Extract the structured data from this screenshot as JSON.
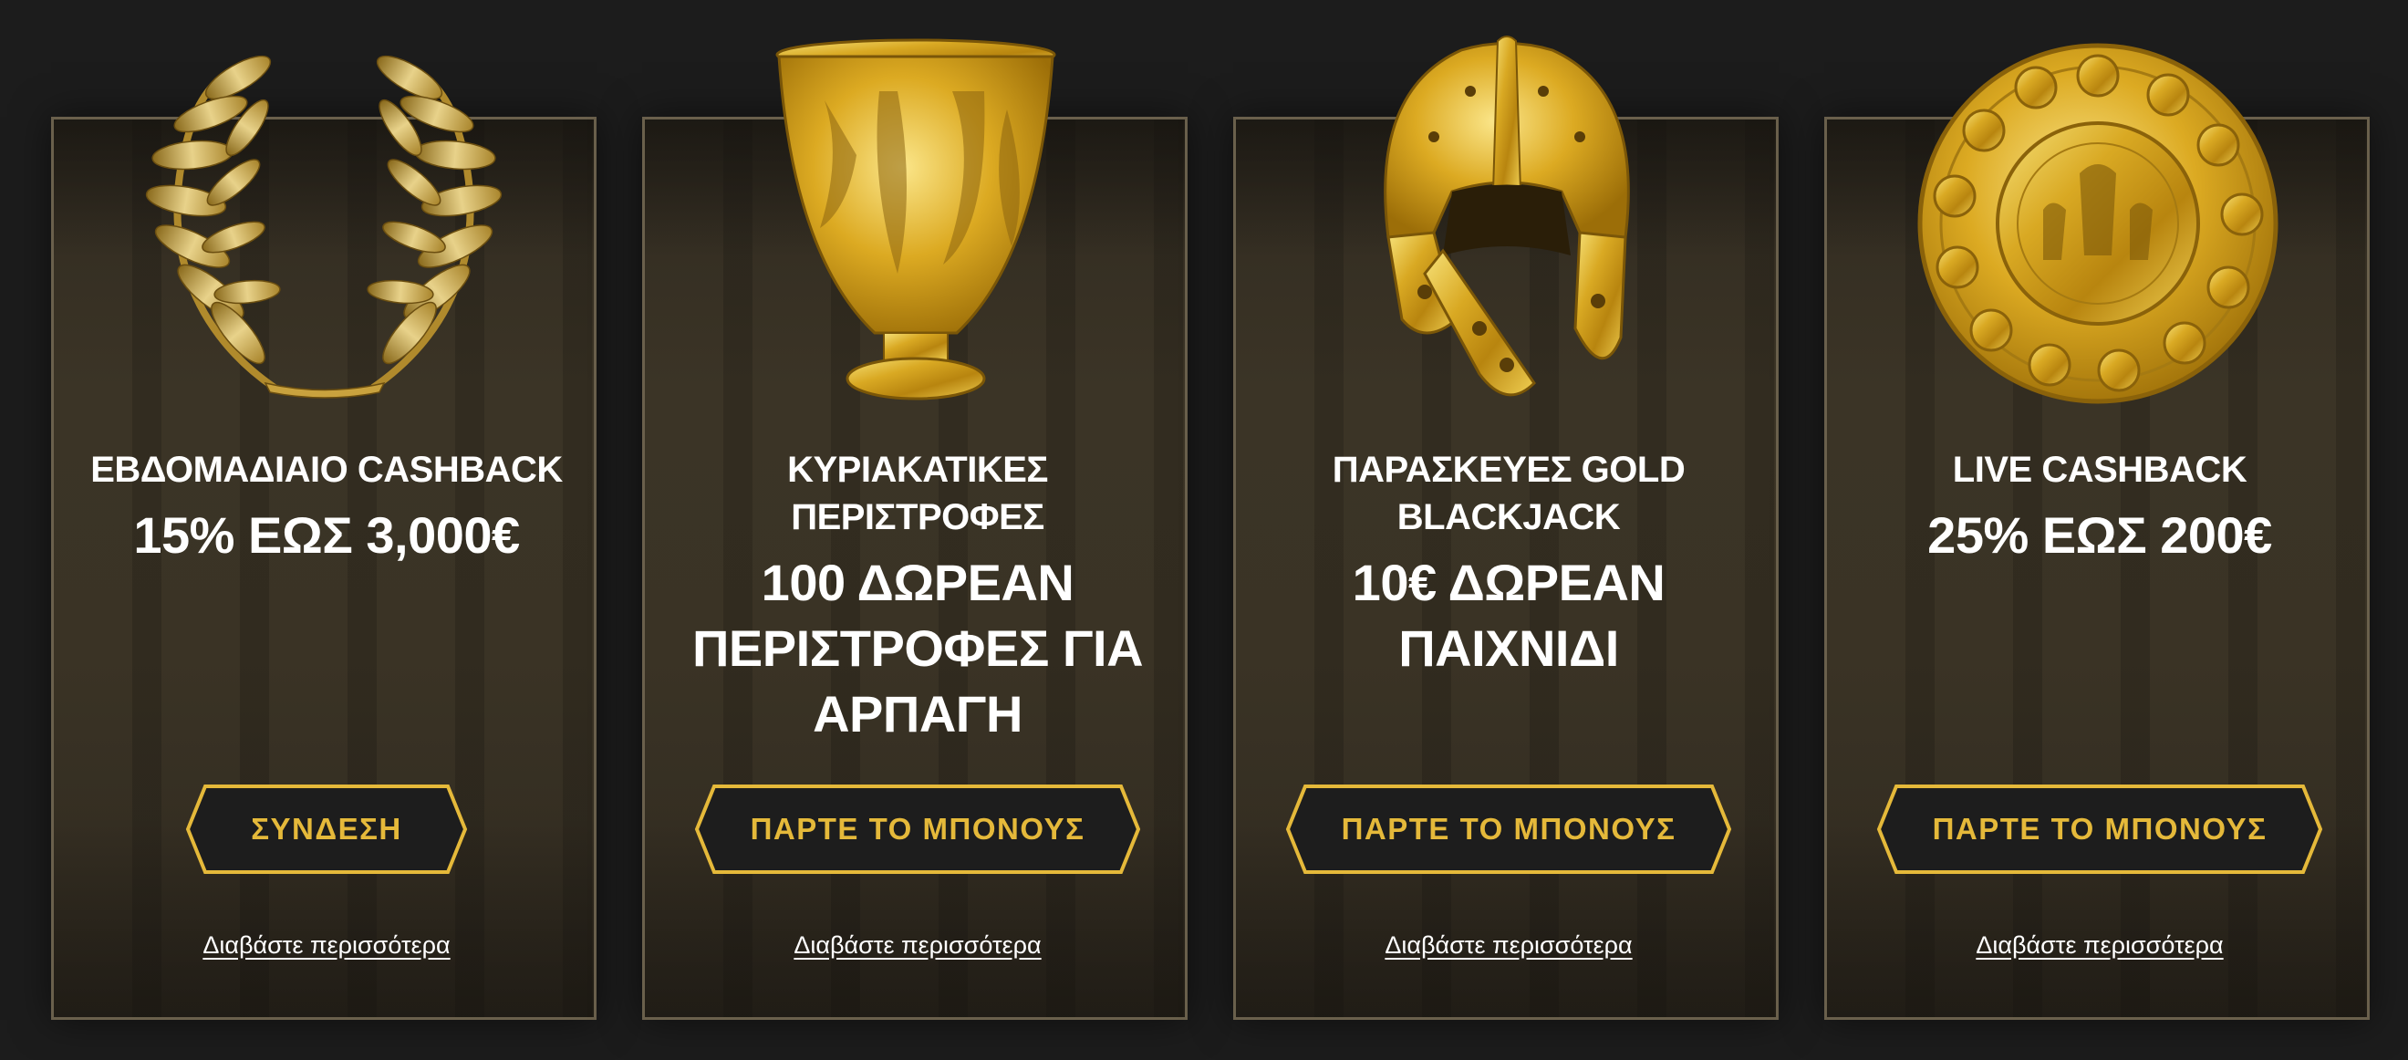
{
  "cards": [
    {
      "icon": "laurel-wreath-icon",
      "title_lines": [
        "ΕΒΔΟΜΑΔΙΑΙΟ CASHBACK"
      ],
      "subtitle_lines": [
        "15% ΕΩΣ 3,000€"
      ],
      "button_label": "ΣΥΝΔΕΣΗ",
      "link_label": "Διαβάστε περισσότερα"
    },
    {
      "icon": "golden-vase-icon",
      "title_lines": [
        "ΚΥΡΙΑΚΑΤΙΚΕΣ",
        "ΠΕΡΙΣΤΡΟΦΕΣ"
      ],
      "subtitle_lines": [
        "100 ΔΩΡΕΑΝ",
        "ΠΕΡΙΣΤΡΟΦΕΣ ΓΙΑ",
        "ΑΡΠΑΓΗ"
      ],
      "button_label": "ΠΑΡΤΕ ΤΟ ΜΠΟΝΟΥΣ",
      "link_label": "Διαβάστε περισσότερα"
    },
    {
      "icon": "golden-helmet-icon",
      "title_lines": [
        "ΠΑΡΑΣΚΕΥΕΣ GOLD",
        "BLACKJACK"
      ],
      "subtitle_lines": [
        "10€ ΔΩΡΕΑΝ",
        "ΠΑΙΧΝΙΔΙ"
      ],
      "button_label": "ΠΑΡΤΕ ΤΟ ΜΠΟΝΟΥΣ",
      "link_label": "Διαβάστε περισσότερα"
    },
    {
      "icon": "golden-shield-icon",
      "title_lines": [
        "LIVE CASHBACK"
      ],
      "subtitle_lines": [
        "25% ΕΩΣ 200€"
      ],
      "button_label": "ΠΑΡΤΕ ΤΟ ΜΠΟΝΟΥΣ",
      "link_label": "Διαβάστε περισσότερα"
    }
  ],
  "colors": {
    "page_background": "#1c1c1c",
    "card_border": "#6a604c",
    "gold": "#e5b93a",
    "button_fill": "#1d1d1d",
    "text": "#ffffff"
  }
}
